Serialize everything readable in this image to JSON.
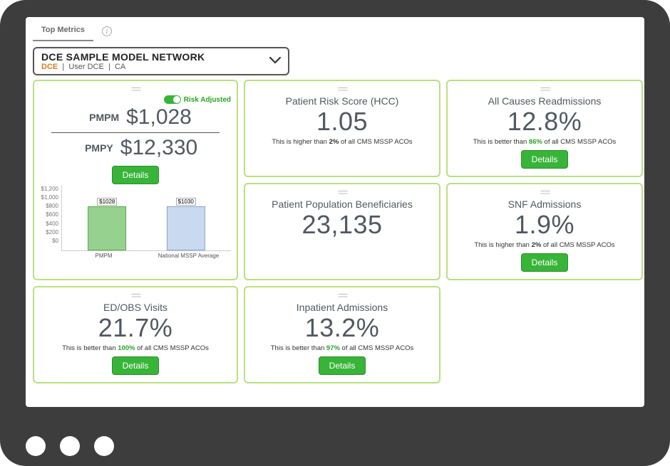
{
  "tabs": {
    "top_metrics": "Top Metrics"
  },
  "selector": {
    "title": "DCE SAMPLE MODEL NETWORK",
    "tag": "DCE",
    "user": "User DCE",
    "region": "CA"
  },
  "pmpm_card": {
    "risk_label": "Risk Adjusted",
    "pmpm_label": "PMPM",
    "pmpm_value": "$1,028",
    "pmpy_label": "PMPY",
    "pmpy_value": "$12,330",
    "details_label": "Details"
  },
  "chart_data": {
    "type": "bar",
    "categories": [
      "PMPM",
      "National MSSP Average"
    ],
    "values": [
      1028,
      1030
    ],
    "value_labels": [
      "$1028",
      "$1030"
    ],
    "ylabel": "",
    "ylim": [
      0,
      1200
    ],
    "yticks": [
      "$0",
      "$200",
      "$400",
      "$600",
      "$800",
      "$1,000",
      "$1,200"
    ]
  },
  "cards": {
    "risk_score": {
      "title": "Patient Risk Score (HCC)",
      "value": "1.05",
      "note_pre": "This is higher than ",
      "note_hl": "2%",
      "note_post": " of all CMS MSSP ACOs",
      "hl_class": "hl-plain"
    },
    "readmissions": {
      "title": "All Causes Readmissions",
      "value": "12.8%",
      "note_pre": "This is better than ",
      "note_hl": "86%",
      "note_post": " of all CMS MSSP ACOs",
      "hl_class": "hl-green",
      "details_label": "Details"
    },
    "population": {
      "title": "Patient Population Beneficiaries",
      "value": "23,135"
    },
    "snf": {
      "title": "SNF Admissions",
      "value": "1.9%",
      "note_pre": "This is higher than ",
      "note_hl": "2%",
      "note_post": " of all CMS MSSP ACOs",
      "hl_class": "hl-plain",
      "details_label": "Details"
    },
    "edobs": {
      "title": "ED/OBS Visits",
      "value": "21.7%",
      "note_pre": "This is better than ",
      "note_hl": "100%",
      "note_post": " of all CMS MSSP ACOs",
      "hl_class": "hl-green",
      "details_label": "Details"
    },
    "inpatient": {
      "title": "Inpatient Admissions",
      "value": "13.2%",
      "note_pre": "This is better than ",
      "note_hl": "97%",
      "note_post": " of all CMS MSSP ACOs",
      "hl_class": "hl-green",
      "details_label": "Details"
    }
  }
}
